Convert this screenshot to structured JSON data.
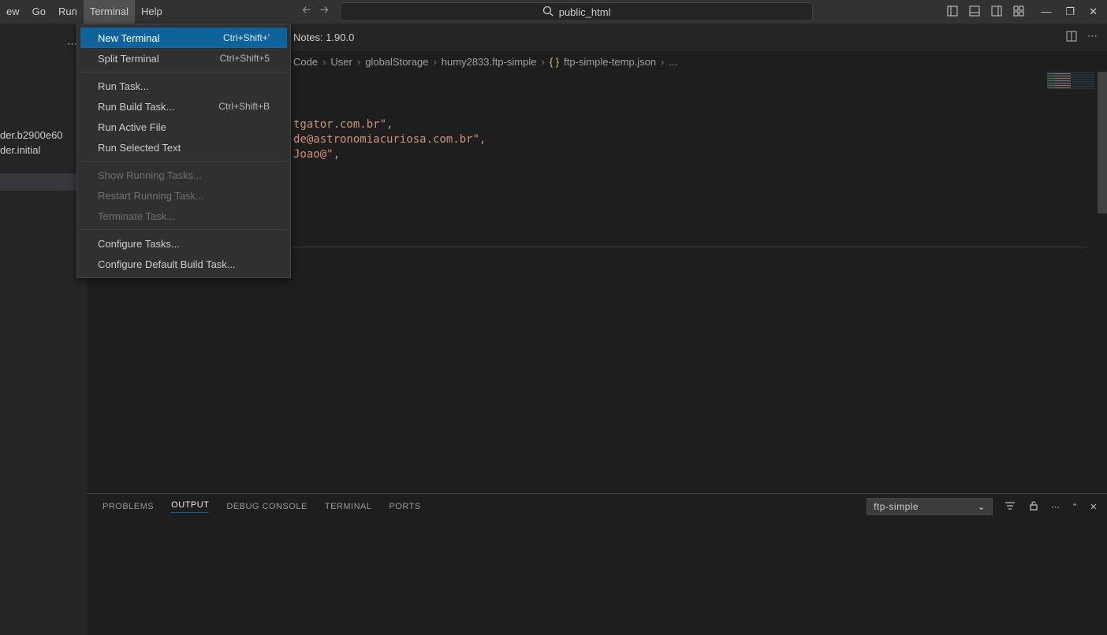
{
  "menubar": {
    "items": [
      "ew",
      "Go",
      "Run",
      "Terminal",
      "Help"
    ],
    "active_index": 3
  },
  "search": {
    "text": "public_html"
  },
  "dropdown": {
    "groups": [
      [
        {
          "label": "New Terminal",
          "shortcut": "Ctrl+Shift+'",
          "selected": true
        },
        {
          "label": "Split Terminal",
          "shortcut": "Ctrl+Shift+5"
        }
      ],
      [
        {
          "label": "Run Task..."
        },
        {
          "label": "Run Build Task...",
          "shortcut": "Ctrl+Shift+B"
        },
        {
          "label": "Run Active File"
        },
        {
          "label": "Run Selected Text"
        }
      ],
      [
        {
          "label": "Show Running Tasks...",
          "disabled": true
        },
        {
          "label": "Restart Running Task...",
          "disabled": true
        },
        {
          "label": "Terminate Task...",
          "disabled": true
        }
      ],
      [
        {
          "label": "Configure Tasks..."
        },
        {
          "label": "Configure Default Build Task..."
        }
      ]
    ]
  },
  "sidebar": {
    "line1": "der.b2900e60",
    "line2": "der.initial"
  },
  "tabrow": {
    "release": "Notes: 1.90.0"
  },
  "breadcrumbs": [
    "Code",
    "User",
    "globalStorage",
    "humy2833.ftp-simple",
    "ftp-simple-temp.json",
    "..."
  ],
  "editor": {
    "lines": [
      "tgator.com.br\",",
      "",
      "",
      "de@astronomiacuriosa.com.br\",",
      "Joao@\","
    ]
  },
  "panel": {
    "tabs": [
      "PROBLEMS",
      "OUTPUT",
      "DEBUG CONSOLE",
      "TERMINAL",
      "PORTS"
    ],
    "active": 1,
    "select": "ftp-simple"
  }
}
